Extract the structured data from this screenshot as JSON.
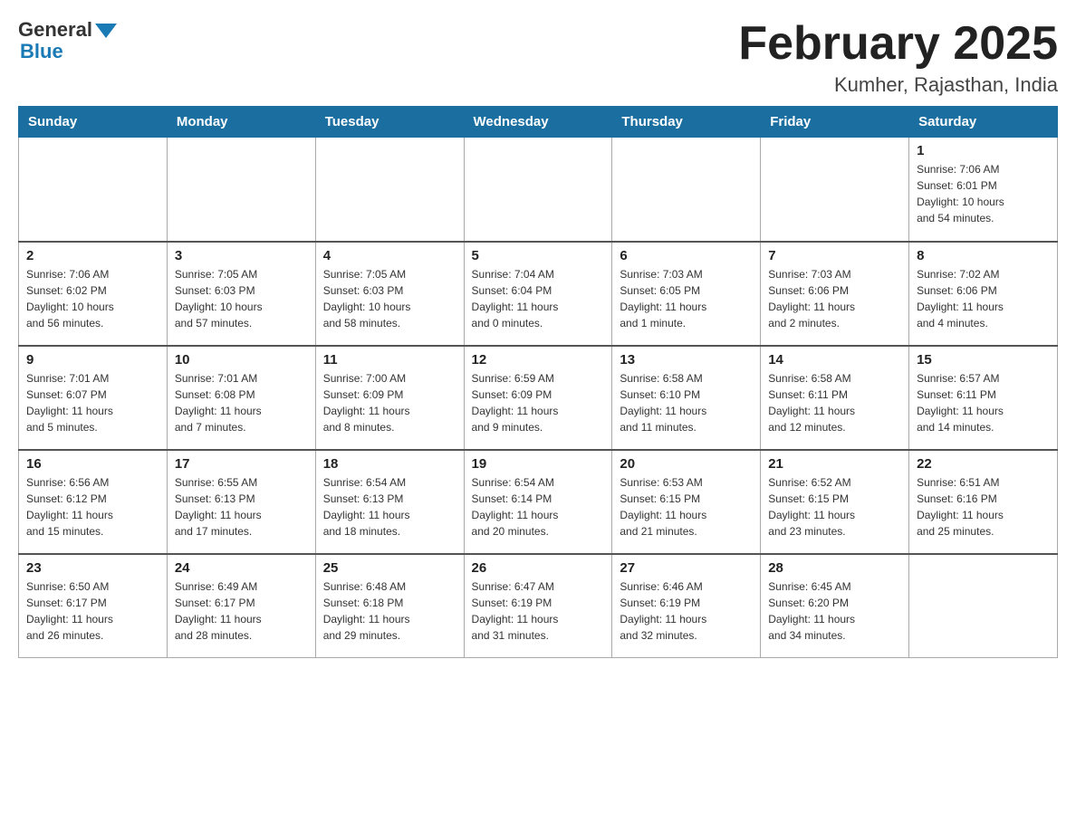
{
  "header": {
    "logo_general": "General",
    "logo_blue": "Blue",
    "title": "February 2025",
    "subtitle": "Kumher, Rajasthan, India"
  },
  "days_of_week": [
    "Sunday",
    "Monday",
    "Tuesday",
    "Wednesday",
    "Thursday",
    "Friday",
    "Saturday"
  ],
  "weeks": [
    {
      "days": [
        {
          "num": "",
          "info": ""
        },
        {
          "num": "",
          "info": ""
        },
        {
          "num": "",
          "info": ""
        },
        {
          "num": "",
          "info": ""
        },
        {
          "num": "",
          "info": ""
        },
        {
          "num": "",
          "info": ""
        },
        {
          "num": "1",
          "info": "Sunrise: 7:06 AM\nSunset: 6:01 PM\nDaylight: 10 hours\nand 54 minutes."
        }
      ]
    },
    {
      "days": [
        {
          "num": "2",
          "info": "Sunrise: 7:06 AM\nSunset: 6:02 PM\nDaylight: 10 hours\nand 56 minutes."
        },
        {
          "num": "3",
          "info": "Sunrise: 7:05 AM\nSunset: 6:03 PM\nDaylight: 10 hours\nand 57 minutes."
        },
        {
          "num": "4",
          "info": "Sunrise: 7:05 AM\nSunset: 6:03 PM\nDaylight: 10 hours\nand 58 minutes."
        },
        {
          "num": "5",
          "info": "Sunrise: 7:04 AM\nSunset: 6:04 PM\nDaylight: 11 hours\nand 0 minutes."
        },
        {
          "num": "6",
          "info": "Sunrise: 7:03 AM\nSunset: 6:05 PM\nDaylight: 11 hours\nand 1 minute."
        },
        {
          "num": "7",
          "info": "Sunrise: 7:03 AM\nSunset: 6:06 PM\nDaylight: 11 hours\nand 2 minutes."
        },
        {
          "num": "8",
          "info": "Sunrise: 7:02 AM\nSunset: 6:06 PM\nDaylight: 11 hours\nand 4 minutes."
        }
      ]
    },
    {
      "days": [
        {
          "num": "9",
          "info": "Sunrise: 7:01 AM\nSunset: 6:07 PM\nDaylight: 11 hours\nand 5 minutes."
        },
        {
          "num": "10",
          "info": "Sunrise: 7:01 AM\nSunset: 6:08 PM\nDaylight: 11 hours\nand 7 minutes."
        },
        {
          "num": "11",
          "info": "Sunrise: 7:00 AM\nSunset: 6:09 PM\nDaylight: 11 hours\nand 8 minutes."
        },
        {
          "num": "12",
          "info": "Sunrise: 6:59 AM\nSunset: 6:09 PM\nDaylight: 11 hours\nand 9 minutes."
        },
        {
          "num": "13",
          "info": "Sunrise: 6:58 AM\nSunset: 6:10 PM\nDaylight: 11 hours\nand 11 minutes."
        },
        {
          "num": "14",
          "info": "Sunrise: 6:58 AM\nSunset: 6:11 PM\nDaylight: 11 hours\nand 12 minutes."
        },
        {
          "num": "15",
          "info": "Sunrise: 6:57 AM\nSunset: 6:11 PM\nDaylight: 11 hours\nand 14 minutes."
        }
      ]
    },
    {
      "days": [
        {
          "num": "16",
          "info": "Sunrise: 6:56 AM\nSunset: 6:12 PM\nDaylight: 11 hours\nand 15 minutes."
        },
        {
          "num": "17",
          "info": "Sunrise: 6:55 AM\nSunset: 6:13 PM\nDaylight: 11 hours\nand 17 minutes."
        },
        {
          "num": "18",
          "info": "Sunrise: 6:54 AM\nSunset: 6:13 PM\nDaylight: 11 hours\nand 18 minutes."
        },
        {
          "num": "19",
          "info": "Sunrise: 6:54 AM\nSunset: 6:14 PM\nDaylight: 11 hours\nand 20 minutes."
        },
        {
          "num": "20",
          "info": "Sunrise: 6:53 AM\nSunset: 6:15 PM\nDaylight: 11 hours\nand 21 minutes."
        },
        {
          "num": "21",
          "info": "Sunrise: 6:52 AM\nSunset: 6:15 PM\nDaylight: 11 hours\nand 23 minutes."
        },
        {
          "num": "22",
          "info": "Sunrise: 6:51 AM\nSunset: 6:16 PM\nDaylight: 11 hours\nand 25 minutes."
        }
      ]
    },
    {
      "days": [
        {
          "num": "23",
          "info": "Sunrise: 6:50 AM\nSunset: 6:17 PM\nDaylight: 11 hours\nand 26 minutes."
        },
        {
          "num": "24",
          "info": "Sunrise: 6:49 AM\nSunset: 6:17 PM\nDaylight: 11 hours\nand 28 minutes."
        },
        {
          "num": "25",
          "info": "Sunrise: 6:48 AM\nSunset: 6:18 PM\nDaylight: 11 hours\nand 29 minutes."
        },
        {
          "num": "26",
          "info": "Sunrise: 6:47 AM\nSunset: 6:19 PM\nDaylight: 11 hours\nand 31 minutes."
        },
        {
          "num": "27",
          "info": "Sunrise: 6:46 AM\nSunset: 6:19 PM\nDaylight: 11 hours\nand 32 minutes."
        },
        {
          "num": "28",
          "info": "Sunrise: 6:45 AM\nSunset: 6:20 PM\nDaylight: 11 hours\nand 34 minutes."
        },
        {
          "num": "",
          "info": ""
        }
      ]
    }
  ]
}
